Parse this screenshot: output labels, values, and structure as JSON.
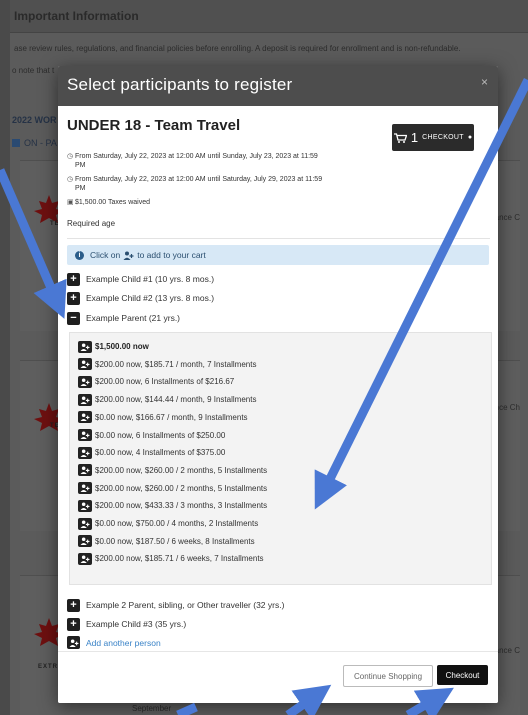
{
  "background": {
    "header_title": "Important Information",
    "line1": "ase review rules, regulations, and financial policies before enrolling.  A deposit is required for enrollment and is non-refundable.",
    "line2": "o note that t",
    "year_label": "2022 WOR",
    "tab_label": "ON - PA",
    "side_text": "Dance C",
    "side_text2": "ance Ch",
    "side_text3": "ance C",
    "logo_text": "TE",
    "logo_text3": "EXTR",
    "footer_text": "September"
  },
  "modal": {
    "title": "Select participants to register",
    "close": "×",
    "event_title": "UNDER 18 - Team Travel",
    "cart_count": "1",
    "checkout_label": "CHECKOUT",
    "dates": [
      {
        "icon": "clock-icon",
        "text": "From Saturday, July 22, 2023 at 12:00 AM until Sunday, July 23, 2023 at 11:59 PM"
      },
      {
        "icon": "clock-icon",
        "text": "From Saturday, July 22, 2023 at 12:00 AM until Saturday, July 29, 2023 at 11:59 PM"
      }
    ],
    "taxes": "$1,500.00 Taxes waived",
    "required_age": "Required age",
    "hint_prefix": "Click on",
    "hint_suffix": "to add to your cart",
    "participants": [
      {
        "label": "Example Child #1 (10 yrs. 8 mos.)",
        "state": "+"
      },
      {
        "label": "Example Child #2 (13 yrs. 8 mos.)",
        "state": "+"
      },
      {
        "label": "Example Parent (21 yrs.)",
        "state": "−"
      }
    ],
    "installments": [
      "$1,500.00 now",
      "$200.00 now, $185.71 / month, 7 Installments",
      "$200.00 now, 6 Installments of $216.67",
      "$200.00 now, $144.44 / month, 9 Installments",
      "$0.00 now, $166.67 / month, 9 Installments",
      "$0.00 now, 6 Installments of $250.00",
      "$0.00 now, 4 Installments of $375.00",
      "$200.00 now, $260.00 / 2 months, 5 Installments",
      "$200.00 now, $260.00 / 2 months, 5 Installments",
      "$200.00 now, $433.33 / 3 months, 3 Installments",
      "$0.00 now, $750.00 / 4 months, 2 Installments",
      "$0.00 now, $187.50 / 6 weeks, 8 Installments",
      "$200.00 now, $185.71 / 6 weeks, 7 Installments"
    ],
    "more_participants": [
      {
        "label": "Example 2 Parent, sibling, or Other traveller (32 yrs.)",
        "state": "+"
      },
      {
        "label": "Example Child #3 (35 yrs.)",
        "state": "+"
      }
    ],
    "add_another": "Add another person",
    "continue_label": "Continue Shopping",
    "checkout_footer": "Checkout"
  },
  "colors": {
    "arrow": "#4a78d4",
    "header": "#4d4d4d",
    "hint_bg": "#d7e8f6",
    "link": "#3a83c7"
  }
}
